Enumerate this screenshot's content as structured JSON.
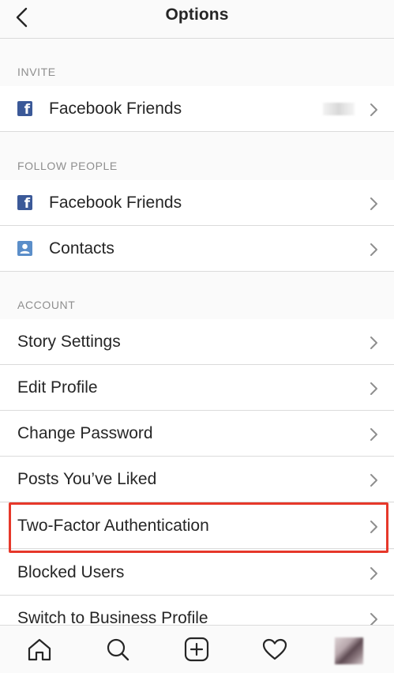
{
  "header": {
    "title": "Options"
  },
  "sections": {
    "invite": {
      "title": "INVITE",
      "items": [
        {
          "label": "Facebook Friends"
        }
      ]
    },
    "follow_people": {
      "title": "FOLLOW PEOPLE",
      "items": [
        {
          "label": "Facebook Friends"
        },
        {
          "label": "Contacts"
        }
      ]
    },
    "account": {
      "title": "ACCOUNT",
      "items": [
        {
          "label": "Story Settings"
        },
        {
          "label": "Edit Profile"
        },
        {
          "label": "Change Password"
        },
        {
          "label": "Posts You’ve Liked"
        },
        {
          "label": "Two-Factor Authentication",
          "highlighted": true
        },
        {
          "label": "Blocked Users"
        },
        {
          "label": "Switch to Business Profile"
        }
      ]
    }
  },
  "tabbar": {
    "tabs": [
      "home-icon",
      "search-icon",
      "add-post-icon",
      "activity-heart-icon",
      "profile-avatar"
    ]
  },
  "colors": {
    "facebook": "#3b5998",
    "contacts": "#5b8ec9",
    "highlight": "#e6382a"
  }
}
